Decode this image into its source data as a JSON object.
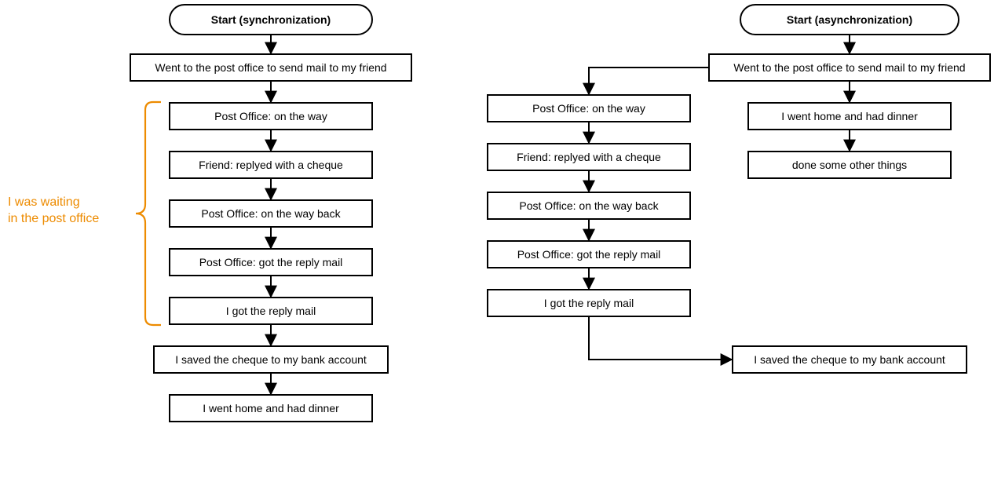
{
  "left": {
    "start": "Start (synchronization)",
    "step1": "Went to the post office to send mail to my friend",
    "step2": "Post Office: on the way",
    "step3": "Friend: replyed with a cheque",
    "step4": "Post Office: on the way back",
    "step5": "Post Office: got the reply mail",
    "step6": "I got the reply mail",
    "step7": "I saved the cheque to my bank account",
    "step8": "I went home and had dinner"
  },
  "right": {
    "start": "Start (asynchronization)",
    "step1": "Went to the post office to send mail to my friend",
    "rightCol1": "I went home and had dinner",
    "rightCol2": "done some other things",
    "step2": "Post Office: on the way",
    "step3": "Friend: replyed with a cheque",
    "step4": "Post Office: on the way back",
    "step5": "Post Office: got the reply mail",
    "step6": "I got the reply mail",
    "step7": "I saved the cheque to my bank account"
  },
  "annotation": "I was waiting\nin the post office",
  "colors": {
    "accent": "#ed8b00"
  }
}
